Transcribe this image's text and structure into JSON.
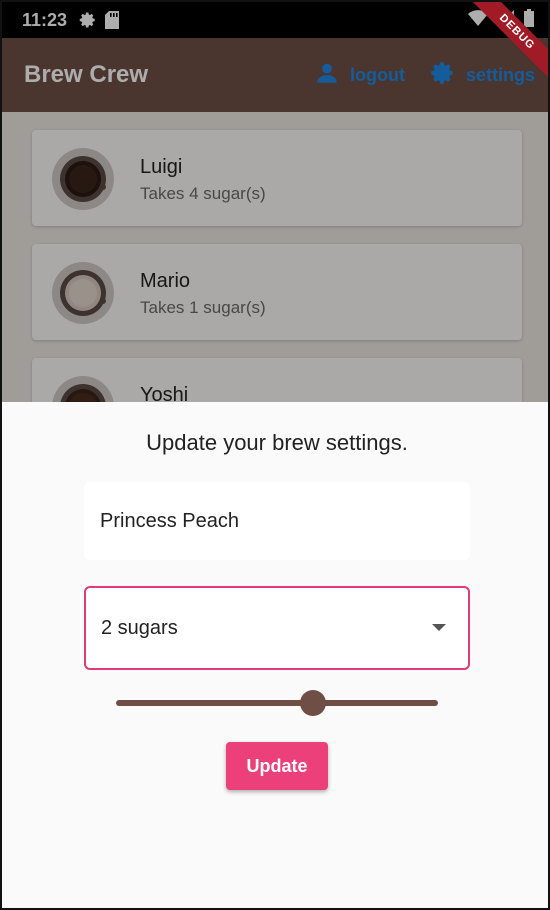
{
  "status_bar": {
    "time": "11:23",
    "icons": [
      "gear-icon",
      "sd-card-icon",
      "wifi-icon",
      "signal-icon",
      "battery-icon"
    ]
  },
  "app_bar": {
    "title": "Brew Crew",
    "logout_label": "logout",
    "settings_label": "settings",
    "color": "#6f4e46",
    "action_color": "#1e88e5"
  },
  "debug_banner": "DEBUG",
  "brews": [
    {
      "name": "Luigi",
      "sugars": "Takes 4 sugar(s)",
      "coffee_color": "#2b1a14"
    },
    {
      "name": "Mario",
      "sugars": "Takes 1 sugar(s)",
      "coffee_color": "#d7c7bd"
    },
    {
      "name": "Yoshi",
      "sugars": "",
      "coffee_color": "#3b2218"
    }
  ],
  "sheet": {
    "title": "Update your brew settings.",
    "name_value": "Princess Peach",
    "sugar_selected": "2 sugars",
    "strength_fraction": 0.62,
    "update_label": "Update",
    "accent": "#ec407a"
  }
}
